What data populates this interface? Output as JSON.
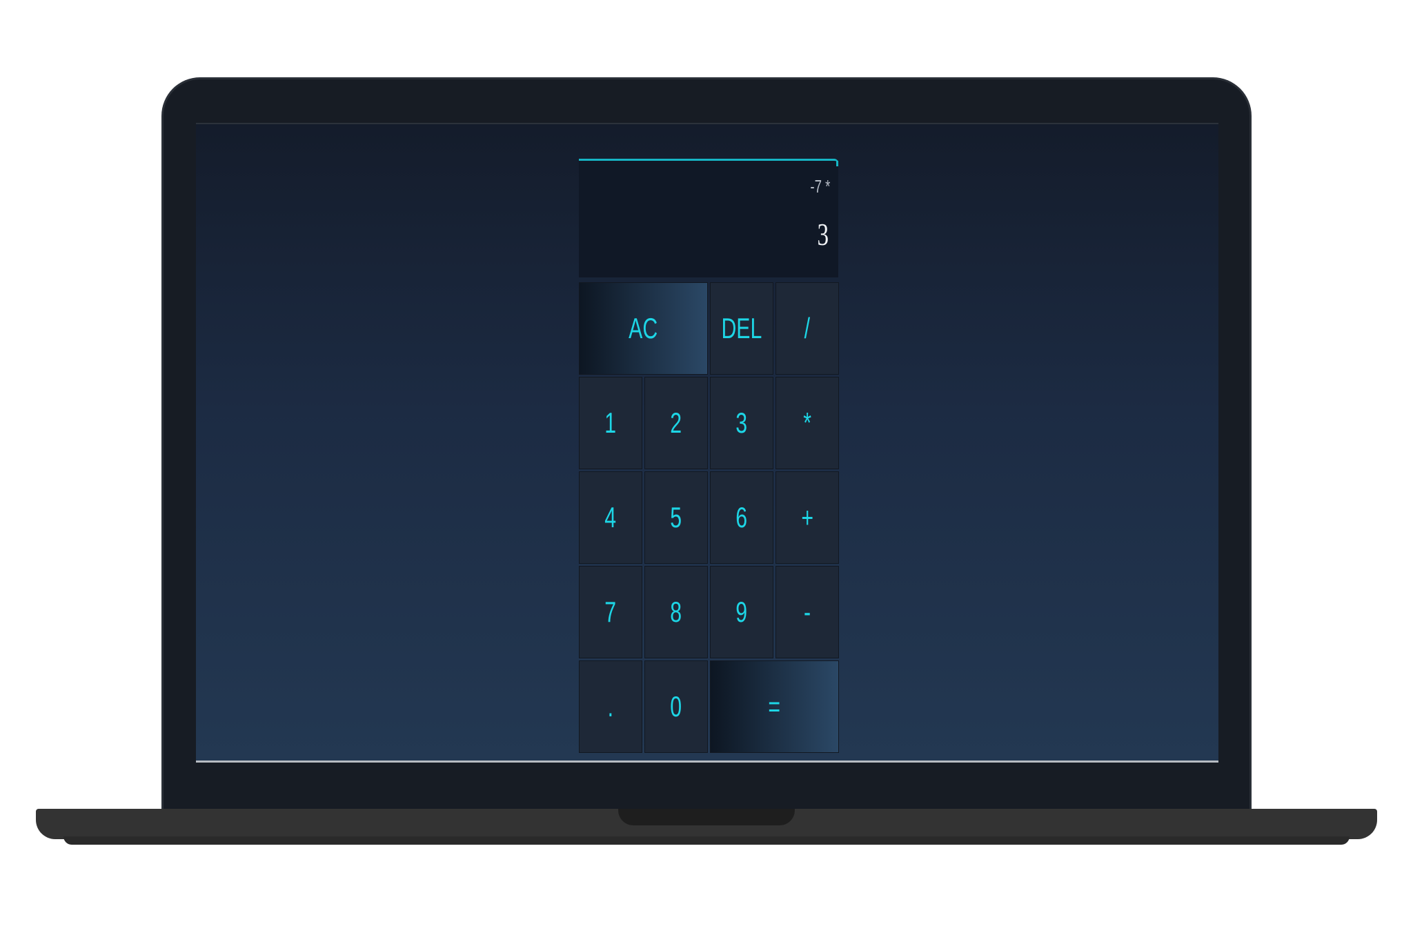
{
  "display": {
    "previous_operand": "-7 *",
    "current_operand": "3"
  },
  "keys": {
    "ac": "AC",
    "del": "DEL",
    "divide": "/",
    "one": "1",
    "two": "2",
    "three": "3",
    "multiply": "*",
    "four": "4",
    "five": "5",
    "six": "6",
    "add": "+",
    "seven": "7",
    "eight": "8",
    "nine": "9",
    "subtract": "-",
    "decimal": ".",
    "zero": "0",
    "equals": "="
  },
  "colors": {
    "accent": "#1dd6e6",
    "key_bg": "#1e2837",
    "screen_bg": "#1c2b43"
  }
}
